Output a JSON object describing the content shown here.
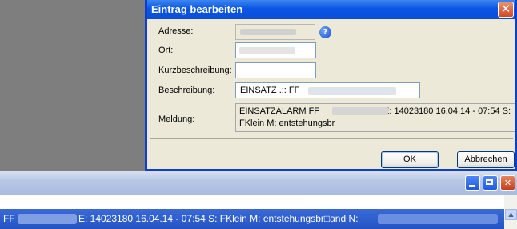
{
  "dialog": {
    "title": "Eintrag bearbeiten",
    "close_glyph": "✕",
    "fields": {
      "adresse_label": "Adresse:",
      "ort_label": "Ort:",
      "kurzbeschreibung_label": "Kurzbeschreibung:",
      "kurzbeschreibung_value": "",
      "beschreibung_label": "Beschreibung:",
      "beschreibung_value": "EINSATZ .:: FF",
      "meldung_label": "Meldung:",
      "meldung_line1_a": "EINSATZALARM    FF",
      "meldung_line1_b": "E: 14023180 16.04.14 - 07:54 S:",
      "meldung_line2": "FKlein M: entstehungsbr"
    },
    "help_icon": "?",
    "ok_label": "OK",
    "cancel_label": "Abbrechen"
  },
  "bottom_window": {
    "ticker_prefix": "FF",
    "ticker_text": "E: 14023180 16.04.14 - 07:54 S: FKlein M: entstehungsbr□and N:"
  },
  "colors": {
    "title_bar": "#0a56e3",
    "ticker": "#2d5ccc",
    "close_button": "#d04a24"
  },
  "icons": [
    "help-icon",
    "close-icon",
    "minimize-icon",
    "maximize-icon",
    "scroll-up-icon"
  ]
}
